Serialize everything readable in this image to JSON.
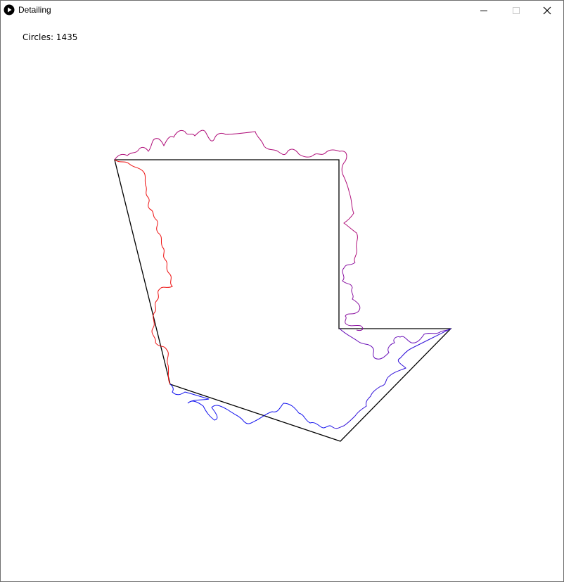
{
  "window": {
    "title": "Detailing",
    "app_icon": "play-circle-icon",
    "controls": {
      "minimize_icon": "minimize-icon",
      "maximize_icon": "maximize-icon",
      "close_icon": "close-icon"
    }
  },
  "canvas": {
    "counter_label": "Circles:",
    "counter_value": "1435",
    "counter_text": "Circles: 1435",
    "colors": {
      "outline": "#000000",
      "start": "#ff0000",
      "end": "#0000ff"
    }
  }
}
